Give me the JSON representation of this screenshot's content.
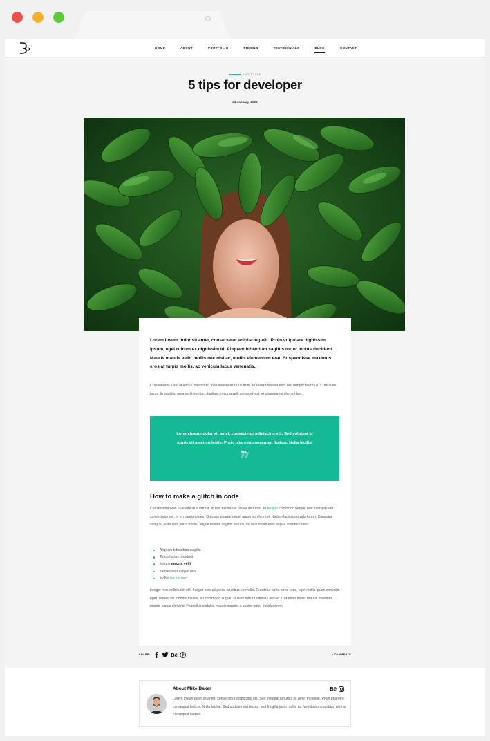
{
  "nav": {
    "items": [
      "HOME",
      "ABOUT",
      "PORTFOLIO",
      "PRICING",
      "TESTIMONIALS",
      "BLOG",
      "CONTACT"
    ],
    "active": "BLOG"
  },
  "post": {
    "category": "LIFESTYLE",
    "title": "5 tips for developer",
    "date": "31 January, 2020",
    "lead": "Lorem ipsum dolor sit amet, consectetur adipiscing elit. Proin vulputate dignissim ipsum, eget rutrum ex dignissim id. Aliquam bibendum sagittis tortor luctus tincidunt. Mauris mauris velit, mollis nec nisi ac, mollis elementum erat. Suspendisse maximus eros at turpis mollis, ac vehicula lacus venenatis.",
    "paragraph1": "Cras lobortis justo at lectus sollicitudin, non venenatis dui rutrum. Praesent laoreet nibh sed tempor faucibus. Cras in ex lacus. In sagittis, urna sed interdum dapibus, magna velit euismod nisl, et pharetra mi diam ut leo.",
    "quote": "Lorem ipsum dolor sit amet, consectetur adipiscing elit. Sed volutpat id turpis sit amet molestie. Proin pharetra consequat finibus. Nulla facilisi sed.",
    "heading": "How to make a glitch in code",
    "paragraph2_before": "Consectetur odio eu eleifend euismod. In hac habitasse platea dictumst. In ",
    "paragraph2_link": "feugiat",
    "paragraph2_after": " commodo neque, non suscipit odio consectetur vel. In in mauris ipsum. Quisque pharetra eget quam non laoreet. Nullam lacinia gravida lorem. Curabitur congue, justo quis porta mollis, augue mauris sagittis mauris, eu accumsan eros augue interdum urna.",
    "list": {
      "item1": "Aliquam bibendum sagittis",
      "item2": "Tortor luctus tincidunt",
      "item3_prefix": "Mauris ",
      "item3_bold": "mauris velit",
      "item4": "Tansectetur aliquet nisi",
      "item5_prefix": "Mollis ",
      "item5_link": "nec nisi",
      "item5_suffix": " act"
    },
    "paragraph3": "Integer non sollicitudin elit. Integer a ex ac purus faucibus convallis. Curabitur porta tortor eros, eget mollis quam convallis eget. Donec vel lobortis massa, eu commodo augue. Nullam rutrum ultricies aliquet. Curabitur mollis mauris maximus mauris varius eleifend. Phasellus sodales mauris mauris, a auctor tortor tincidunt non."
  },
  "share": {
    "label": "SHARE:",
    "icons": [
      "facebook-icon",
      "twitter-icon",
      "behance-icon",
      "pinterest-icon"
    ],
    "behance_text": "Bē",
    "comments": "2 COMMENTS"
  },
  "author": {
    "name": "About Mike Baker",
    "bio": "Lorem ipsum dolor sit amet, consectetur adipiscing elit. Sed volutpat id turpis sit amet molestie. Proin pharetra consequat finibus. Nulla facilisi. Sed sodales nisl lectus, sed fringilla justo mollis ac. Vestibulum dapibus, nibh a consequat laoreet.",
    "behance_text": "Bē"
  },
  "colors": {
    "accent": "#14b996",
    "close_dot": "#f2504b",
    "minimize_dot": "#f4b12e",
    "maximize_dot": "#5fc93c"
  }
}
